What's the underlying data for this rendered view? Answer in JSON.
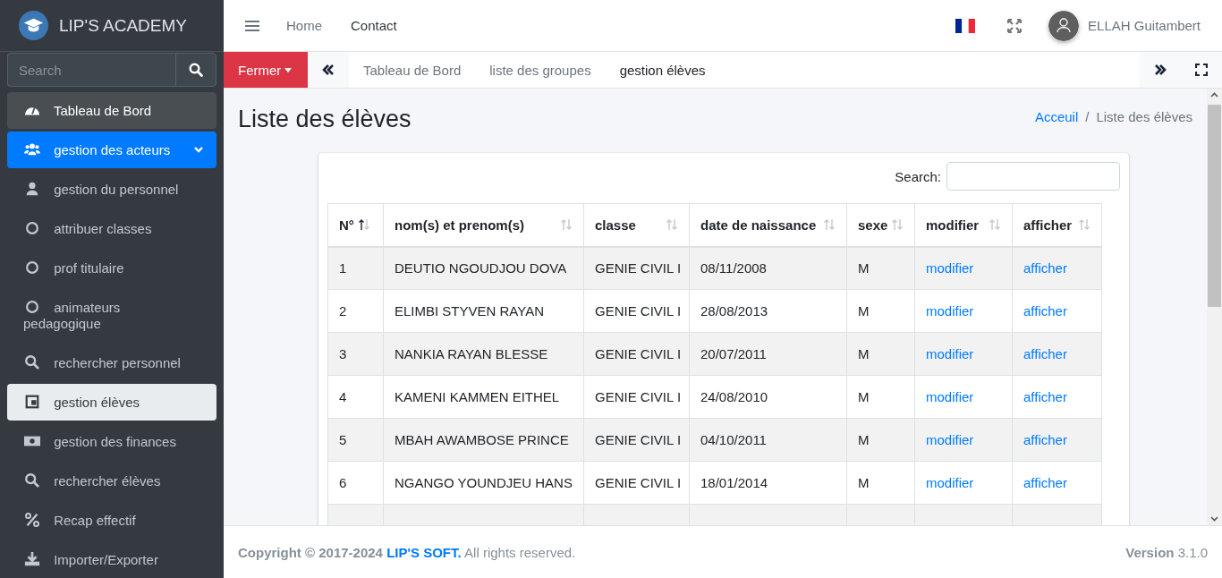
{
  "brand": {
    "name": "LIP'S ACADEMY"
  },
  "sidebar": {
    "search": {
      "placeholder": "Search"
    },
    "items": [
      {
        "label": "Tableau de Bord",
        "kind": "shaded",
        "selected": false
      },
      {
        "label": "gestion des acteurs",
        "kind": "group",
        "expanded": true,
        "selected": false
      },
      {
        "label": "gestion du personnel",
        "kind": "plain",
        "selected": false
      },
      {
        "label": "attribuer classes",
        "kind": "plain",
        "selected": false
      },
      {
        "label": "prof titulaire",
        "kind": "plain",
        "selected": false
      },
      {
        "label": "animateurs pedagogique",
        "kind": "plain",
        "selected": false
      },
      {
        "label": "rechercher personnel",
        "kind": "plain",
        "selected": false
      },
      {
        "label": "gestion élèves",
        "kind": "plain",
        "selected": true
      },
      {
        "label": "gestion des finances",
        "kind": "plain",
        "selected": false
      },
      {
        "label": "rechercher élèves",
        "kind": "plain",
        "selected": false
      },
      {
        "label": "Recap effectif",
        "kind": "plain",
        "selected": false
      },
      {
        "label": "Importer/Exporter",
        "kind": "plain",
        "selected": false
      }
    ]
  },
  "topnav": {
    "links": [
      "Home",
      "Contact"
    ],
    "user": "ELLAH Guitambert"
  },
  "tabbar": {
    "close_button": "Fermer",
    "tabs": [
      {
        "label": "Tableau de Bord",
        "selected": false
      },
      {
        "label": "liste des groupes",
        "selected": false
      },
      {
        "label": "gestion élèves",
        "selected": true
      }
    ]
  },
  "page": {
    "title": "Liste des élèves",
    "breadcrumb": [
      "Acceuil",
      "Liste des élèves"
    ],
    "breadcrumb_separator": "/"
  },
  "table": {
    "search_label": "Search:",
    "columns": [
      {
        "label": "N°",
        "sorted": true
      },
      {
        "label": "nom(s) et prenom(s)",
        "sorted": false
      },
      {
        "label": "classe",
        "sorted": false
      },
      {
        "label": "date de naissance",
        "sorted": false
      },
      {
        "label": "sexe",
        "sorted": false
      },
      {
        "label": "modifier",
        "sorted": false
      },
      {
        "label": "afficher",
        "sorted": false
      }
    ],
    "rows": [
      [
        "1",
        "DEUTIO NGOUDJOU DOVA",
        "GENIE CIVIL I",
        "08/11/2008",
        "M",
        "modifier",
        "afficher"
      ],
      [
        "2",
        "ELIMBI STYVEN RAYAN",
        "GENIE CIVIL I",
        "28/08/2013",
        "M",
        "modifier",
        "afficher"
      ],
      [
        "3",
        "NANKIA RAYAN BLESSE",
        "GENIE CIVIL I",
        "20/07/2011",
        "M",
        "modifier",
        "afficher"
      ],
      [
        "4",
        "KAMENI KAMMEN EITHEL",
        "GENIE CIVIL I",
        "24/08/2010",
        "M",
        "modifier",
        "afficher"
      ],
      [
        "5",
        "MBAH AWAMBOSE PRINCE",
        "GENIE CIVIL I",
        "04/10/2011",
        "M",
        "modifier",
        "afficher"
      ],
      [
        "6",
        "NGANGO YOUNDJEU HANS",
        "GENIE CIVIL I",
        "18/01/2014",
        "M",
        "modifier",
        "afficher"
      ]
    ]
  },
  "footer": {
    "copyright": "**Copyright © 2017-2024**",
    "company": "LIP'S SOFT.",
    "rights": "All rights reserved.",
    "version": "**Version** 3.1.0"
  }
}
